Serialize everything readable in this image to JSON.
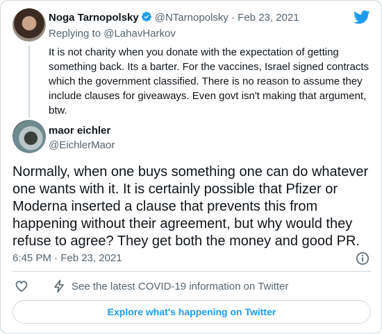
{
  "original_tweet": {
    "author_name": "Noga Tarnopolsky",
    "handle_time": "@NTarnopolsky · Feb 23, 2021",
    "replying_prefix": "Replying to",
    "replying_to": "@LahavHarkov",
    "text": "It is not charity when you donate with the expectation of getting something back. Its a barter. For the vaccines, Israel signed contracts which the government classified. There is no reason to assume they include clauses for giveaways. Even govt isn't making that argument, btw."
  },
  "reply_tweet": {
    "author_name": "maor eichler",
    "handle": "@EichlerMaor",
    "text": "Normally, when one buys something one can do whatever one wants with it. It is certainly possible that Pfizer or Moderna inserted a clause that prevents this from happening without their agreement, but why would they refuse to agree? They get both the money and good PR.",
    "timestamp": "6:45 PM · Feb 23, 2021"
  },
  "actions": {
    "covid_info": "See the latest COVID-19 information on Twitter",
    "explore_button": "Explore what's happening on Twitter"
  },
  "colors": {
    "accent": "#1d9bf0",
    "secondary_text": "#536471",
    "border": "#cfd9de"
  },
  "icons": [
    "twitter-bird-icon",
    "verified-badge-icon",
    "info-icon",
    "heart-icon",
    "lightning-bolt-icon"
  ]
}
